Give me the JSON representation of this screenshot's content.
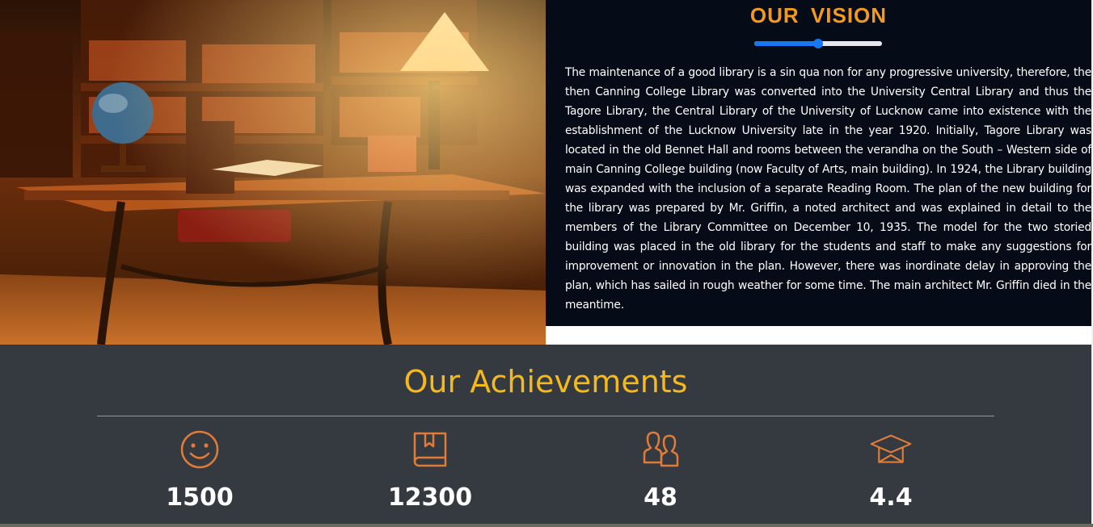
{
  "vision": {
    "title": "OUR  VISION",
    "slider_level": 0.5,
    "slider_color": "#1877f2",
    "paragraph": "The maintenance of a good library is a sin qua non for any progressive university, therefore, the then Canning College Library was converted into the University Central Library and thus the Tagore Library, the Central Library of the University of Lucknow came into existence with the establishment of the Lucknow University late in the year 1920. Initially, Tagore Library was located in the old Bennet Hall and rooms between the verandha on the South – Western side of main Canning College building (now Faculty of Arts, main building). In 1924, the Library building was expanded with the inclusion of a separate Reading Room. The plan of the new building for the library was prepared by Mr. Griffin, a noted architect and was explained in detail to the members of the Library Committee on December 10, 1935. The model for the two storied building was placed in the old library for the students and staff to make any suggestions for improvement or innovation in the plan. However, there was inordinate delay in approving the plan, which has sailed in rough weather for some time. The main architect Mr. Griffin died in the meantime."
  },
  "photo": {
    "image": "library-room-with-desk-globe-lamp"
  },
  "achievements": {
    "title": "Our Achievements",
    "accent_color": "#e07b39",
    "title_color": "#f5b91c",
    "stats": [
      {
        "icon": "smiley-icon",
        "value": "1500"
      },
      {
        "icon": "book-icon",
        "value": "12300"
      },
      {
        "icon": "users-icon",
        "value": "48"
      },
      {
        "icon": "graduation-cap-icon",
        "value": "4.4"
      }
    ]
  }
}
